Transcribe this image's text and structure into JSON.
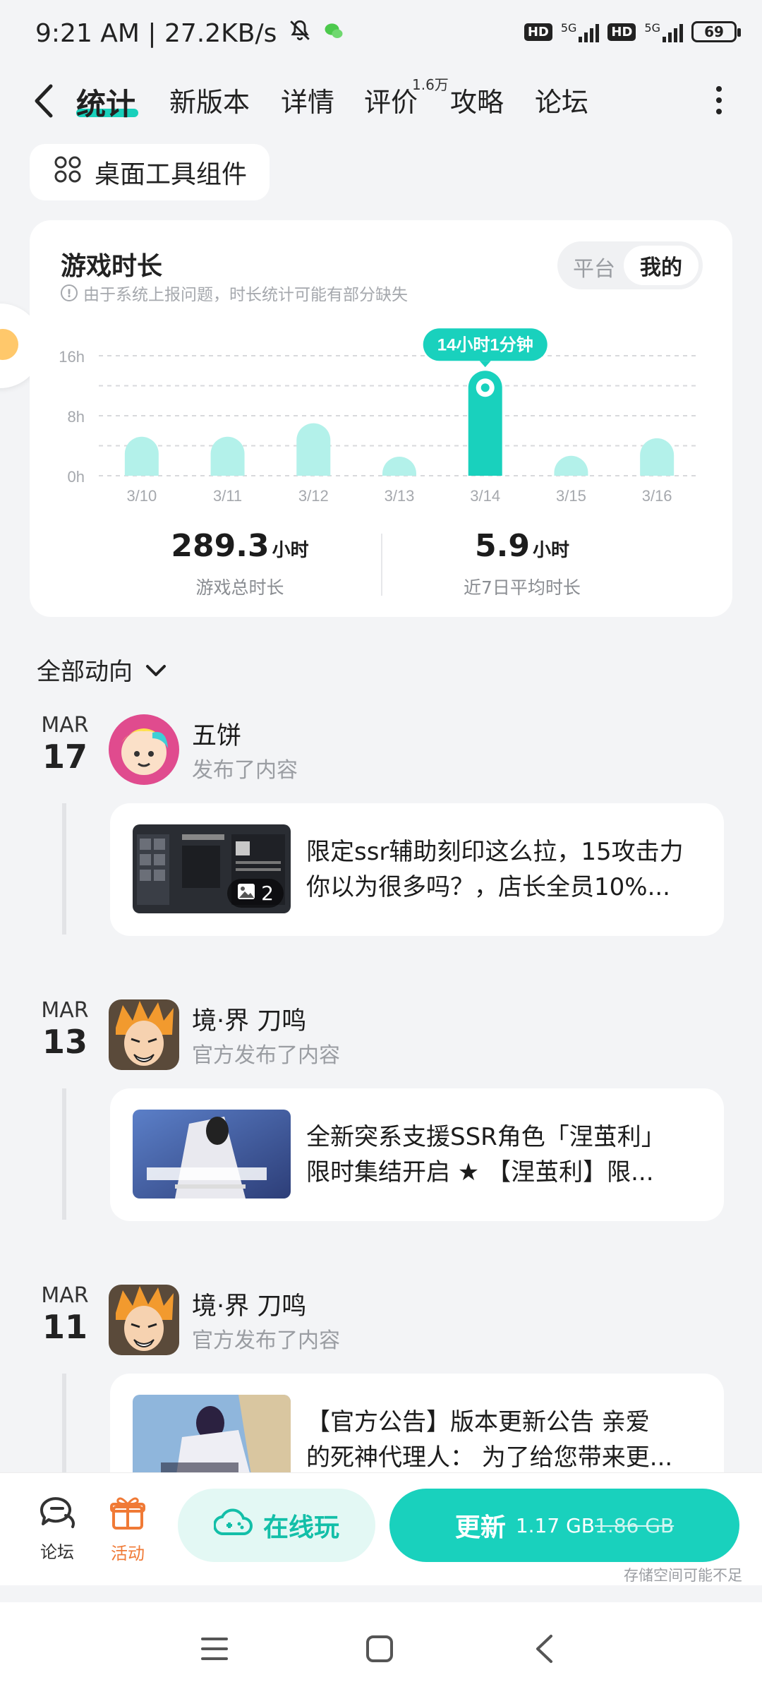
{
  "status_bar": {
    "time_speed": "9:21 AM | 27.2KB/s",
    "net1": "5G",
    "net2": "5G",
    "hd": "HD",
    "battery": "69"
  },
  "tabs": [
    {
      "label": "统计",
      "active": true
    },
    {
      "label": "新版本"
    },
    {
      "label": "详情"
    },
    {
      "label": "评价",
      "badge": "1.6万"
    },
    {
      "label": "攻略"
    },
    {
      "label": "论坛"
    }
  ],
  "widget_chip": {
    "label": "桌面工具组件"
  },
  "stats": {
    "title": "游戏时长",
    "note": "由于系统上报问题，时长统计可能有部分缺失",
    "toggle": {
      "platform": "平台",
      "mine": "我的"
    },
    "total_value": "289.3",
    "total_unit": "小时",
    "total_label": "游戏总时长",
    "avg_value": "5.9",
    "avg_unit": "小时",
    "avg_label": "近7日平均时长"
  },
  "chart_data": {
    "type": "bar",
    "categories": [
      "3/10",
      "3/11",
      "3/12",
      "3/13",
      "3/14",
      "3/15",
      "3/16"
    ],
    "values": [
      5.2,
      5.2,
      7.0,
      0,
      14.0,
      0.8,
      5.0
    ],
    "highlight_index": 4,
    "highlight_label": "14小时1分钟",
    "ylim": [
      0,
      16
    ],
    "yticks": [
      "0h",
      "8h",
      "16h"
    ],
    "ytick_values": [
      0,
      8,
      16
    ],
    "grid": true,
    "colors": {
      "bar": "#b3f1ea",
      "highlight": "#19d1bd"
    }
  },
  "feed": {
    "filter_label": "全部动向",
    "items": [
      {
        "month": "MAR",
        "day": "17",
        "user": "五饼",
        "action": "发布了内容",
        "line1": "限定ssr辅助刻印这么拉，15攻击力",
        "line2": "你以为很多吗？，店长全员10%...",
        "image_count": "2"
      },
      {
        "month": "MAR",
        "day": "13",
        "user": "境·界 刀鸣",
        "action": "官方发布了内容",
        "line1": "全新突系支援SSR角色「涅茧利」",
        "line2": "限时集结开启 ★ 【涅茧利】限..."
      },
      {
        "month": "MAR",
        "day": "11",
        "user": "境·界 刀鸣",
        "action": "官方发布了内容",
        "line1": "【官方公告】版本更新公告 亲爱",
        "line2": "的死神代理人： 为了给您带来更..."
      }
    ]
  },
  "bottom_bar": {
    "forum": "论坛",
    "activity": "活动",
    "play_online": "在线玩",
    "update": "更新",
    "new_size": "1.17 GB",
    "old_size": "1.86 GB",
    "storage_note": "存储空间可能不足"
  }
}
